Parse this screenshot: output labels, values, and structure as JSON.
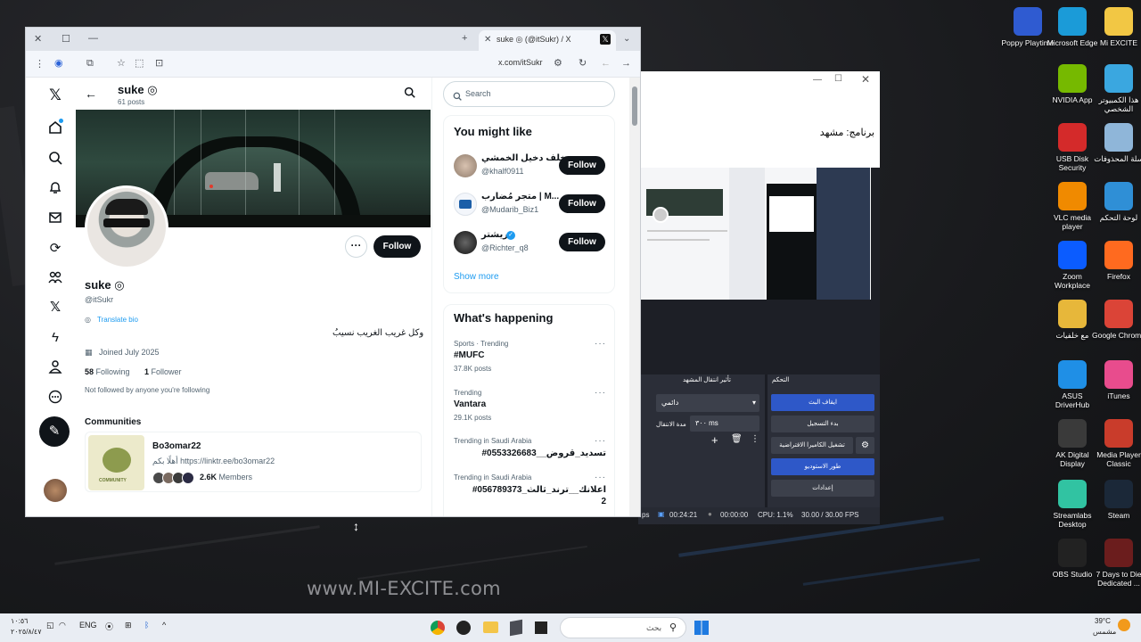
{
  "watermark": "www.MI-EXCITE.com",
  "desktop_icons": [
    {
      "label": "Poppy Playtime",
      "icon": "poppy-playtime-icon",
      "color": "#2f5bd1"
    },
    {
      "label": "Microsoft Edge",
      "icon": "edge-icon",
      "color": "#1b9bd8"
    },
    {
      "label": "Mi EXCITE",
      "icon": "folder-icon",
      "color": "#f2c744"
    },
    {
      "label": "NVIDIA App",
      "icon": "nvidia-icon",
      "color": "#76b900"
    },
    {
      "label": "هذا الكمبيوتر الشخصي",
      "icon": "this-pc-icon",
      "color": "#3aa7e0"
    },
    {
      "label": "USB Disk Security",
      "icon": "usb-shield-icon",
      "color": "#d42a2a"
    },
    {
      "label": "سلة المحذوفات",
      "icon": "recycle-bin-icon",
      "color": "#8fb6d9"
    },
    {
      "label": "VLC media player",
      "icon": "vlc-icon",
      "color": "#f08a00"
    },
    {
      "label": "لوحة التحكم",
      "icon": "control-panel-icon",
      "color": "#2f8fd6"
    },
    {
      "label": "Zoom Workplace",
      "icon": "zoom-icon",
      "color": "#0b5cff"
    },
    {
      "label": "Firefox",
      "icon": "firefox-icon",
      "color": "#ff6a1f"
    },
    {
      "label": "مع خلفيات",
      "icon": "folder-icon",
      "color": "#e7b73a"
    },
    {
      "label": "Google Chrome",
      "icon": "chrome-icon",
      "color": "#db4437"
    },
    {
      "label": "ASUS DriverHub",
      "icon": "asus-driverhub-icon",
      "color": "#1f8fe6"
    },
    {
      "label": "iTunes",
      "icon": "itunes-icon",
      "color": "#e84c8d"
    },
    {
      "label": "AK Digital Display",
      "icon": "ak-digital-icon",
      "color": "#3a3a3a"
    },
    {
      "label": "Media Player Classic",
      "icon": "media-player-classic-icon",
      "color": "#c93c2b"
    },
    {
      "label": "Streamlabs Desktop",
      "icon": "streamlabs-icon",
      "color": "#31c3a2"
    },
    {
      "label": "Steam",
      "icon": "steam-icon",
      "color": "#1b2838"
    },
    {
      "label": "OBS Studio",
      "icon": "obs-icon",
      "color": "#222"
    },
    {
      "label": "7 Days to Die Dedicated ...",
      "icon": "7dtd-icon",
      "color": "#6b1d1d"
    }
  ],
  "obs": {
    "scene_label": "برنامج: مشهد",
    "transition_dock_title": "تأثير انتقال المشهد",
    "controls_dock_title": "التحكم",
    "transition_value": "دائمي",
    "duration_label": "مدة الانتقال",
    "duration_value": "٣٠٠ ms",
    "buttons": [
      "ايقاف البث",
      "بدء التسجيل",
      "تشغيل الكاميرا الافتراضية",
      "طور الاستوديو",
      "إعدادات"
    ],
    "status": {
      "time1": "00:24:21",
      "time2": "00:00:00",
      "cpu": "CPU: 1.1%",
      "fps": "30.00 / 30.00 FPS",
      "ps": "ps"
    }
  },
  "browser": {
    "tab_title": "suke ◎ (@itSukr) / X",
    "url": "x.com/itSukr"
  },
  "profile": {
    "name": "suke ◎",
    "posts": "61 posts",
    "handle": "@itSukr",
    "translate": "Translate bio",
    "bio": "وكل غريب الغريب نسيبُ",
    "joined": "Joined July 2025",
    "following_count": "58",
    "following_label": "Following",
    "followers_count": "1",
    "followers_label": "Follower",
    "not_followed": "Not followed by anyone you're following",
    "follow_label": "Follow",
    "communities_title": "Communities",
    "community": {
      "name": "Bo3omar22",
      "desc": "أهلًا بكم https://linktr.ee/bo3omar22",
      "members": "2.6K",
      "members_label": "Members",
      "badge": "COMMUNITY"
    }
  },
  "search_placeholder": "Search",
  "you_might_like": {
    "title": "You might like",
    "users": [
      {
        "name": "خلف دخيل الخمشي",
        "handle": "@khalf0911",
        "follow": "Follow"
      },
      {
        "name": "متجر مُضارب | M...",
        "handle": "@Mudarib_Biz1",
        "follow": "Follow"
      },
      {
        "name": "ريشتر",
        "handle": "@Richter_q8",
        "follow": "Follow",
        "verified": true
      }
    ],
    "show_more": "Show more"
  },
  "whats_happening": {
    "title": "What's happening",
    "trends": [
      {
        "meta": "Sports · Trending",
        "name": "#MUFC",
        "posts": "37.8K posts"
      },
      {
        "meta": "Trending",
        "name": "Vantara",
        "posts": "29.1K posts"
      },
      {
        "meta": "Trending in Saudi Arabia",
        "name": "#تسديد_قروض__0553326683",
        "posts": ""
      },
      {
        "meta": "Trending in Saudi Arabia",
        "name": "#اعلانك__ترند_ثالث_056789373",
        "name2": "2",
        "posts": ""
      }
    ]
  },
  "taskbar": {
    "time": "١٠:٥٦",
    "date": "٢٠٢٥/٨/٤٧",
    "lang": "ENG",
    "search_placeholder": "بحث",
    "weather": "39°C",
    "weather_desc": "مشمس"
  }
}
